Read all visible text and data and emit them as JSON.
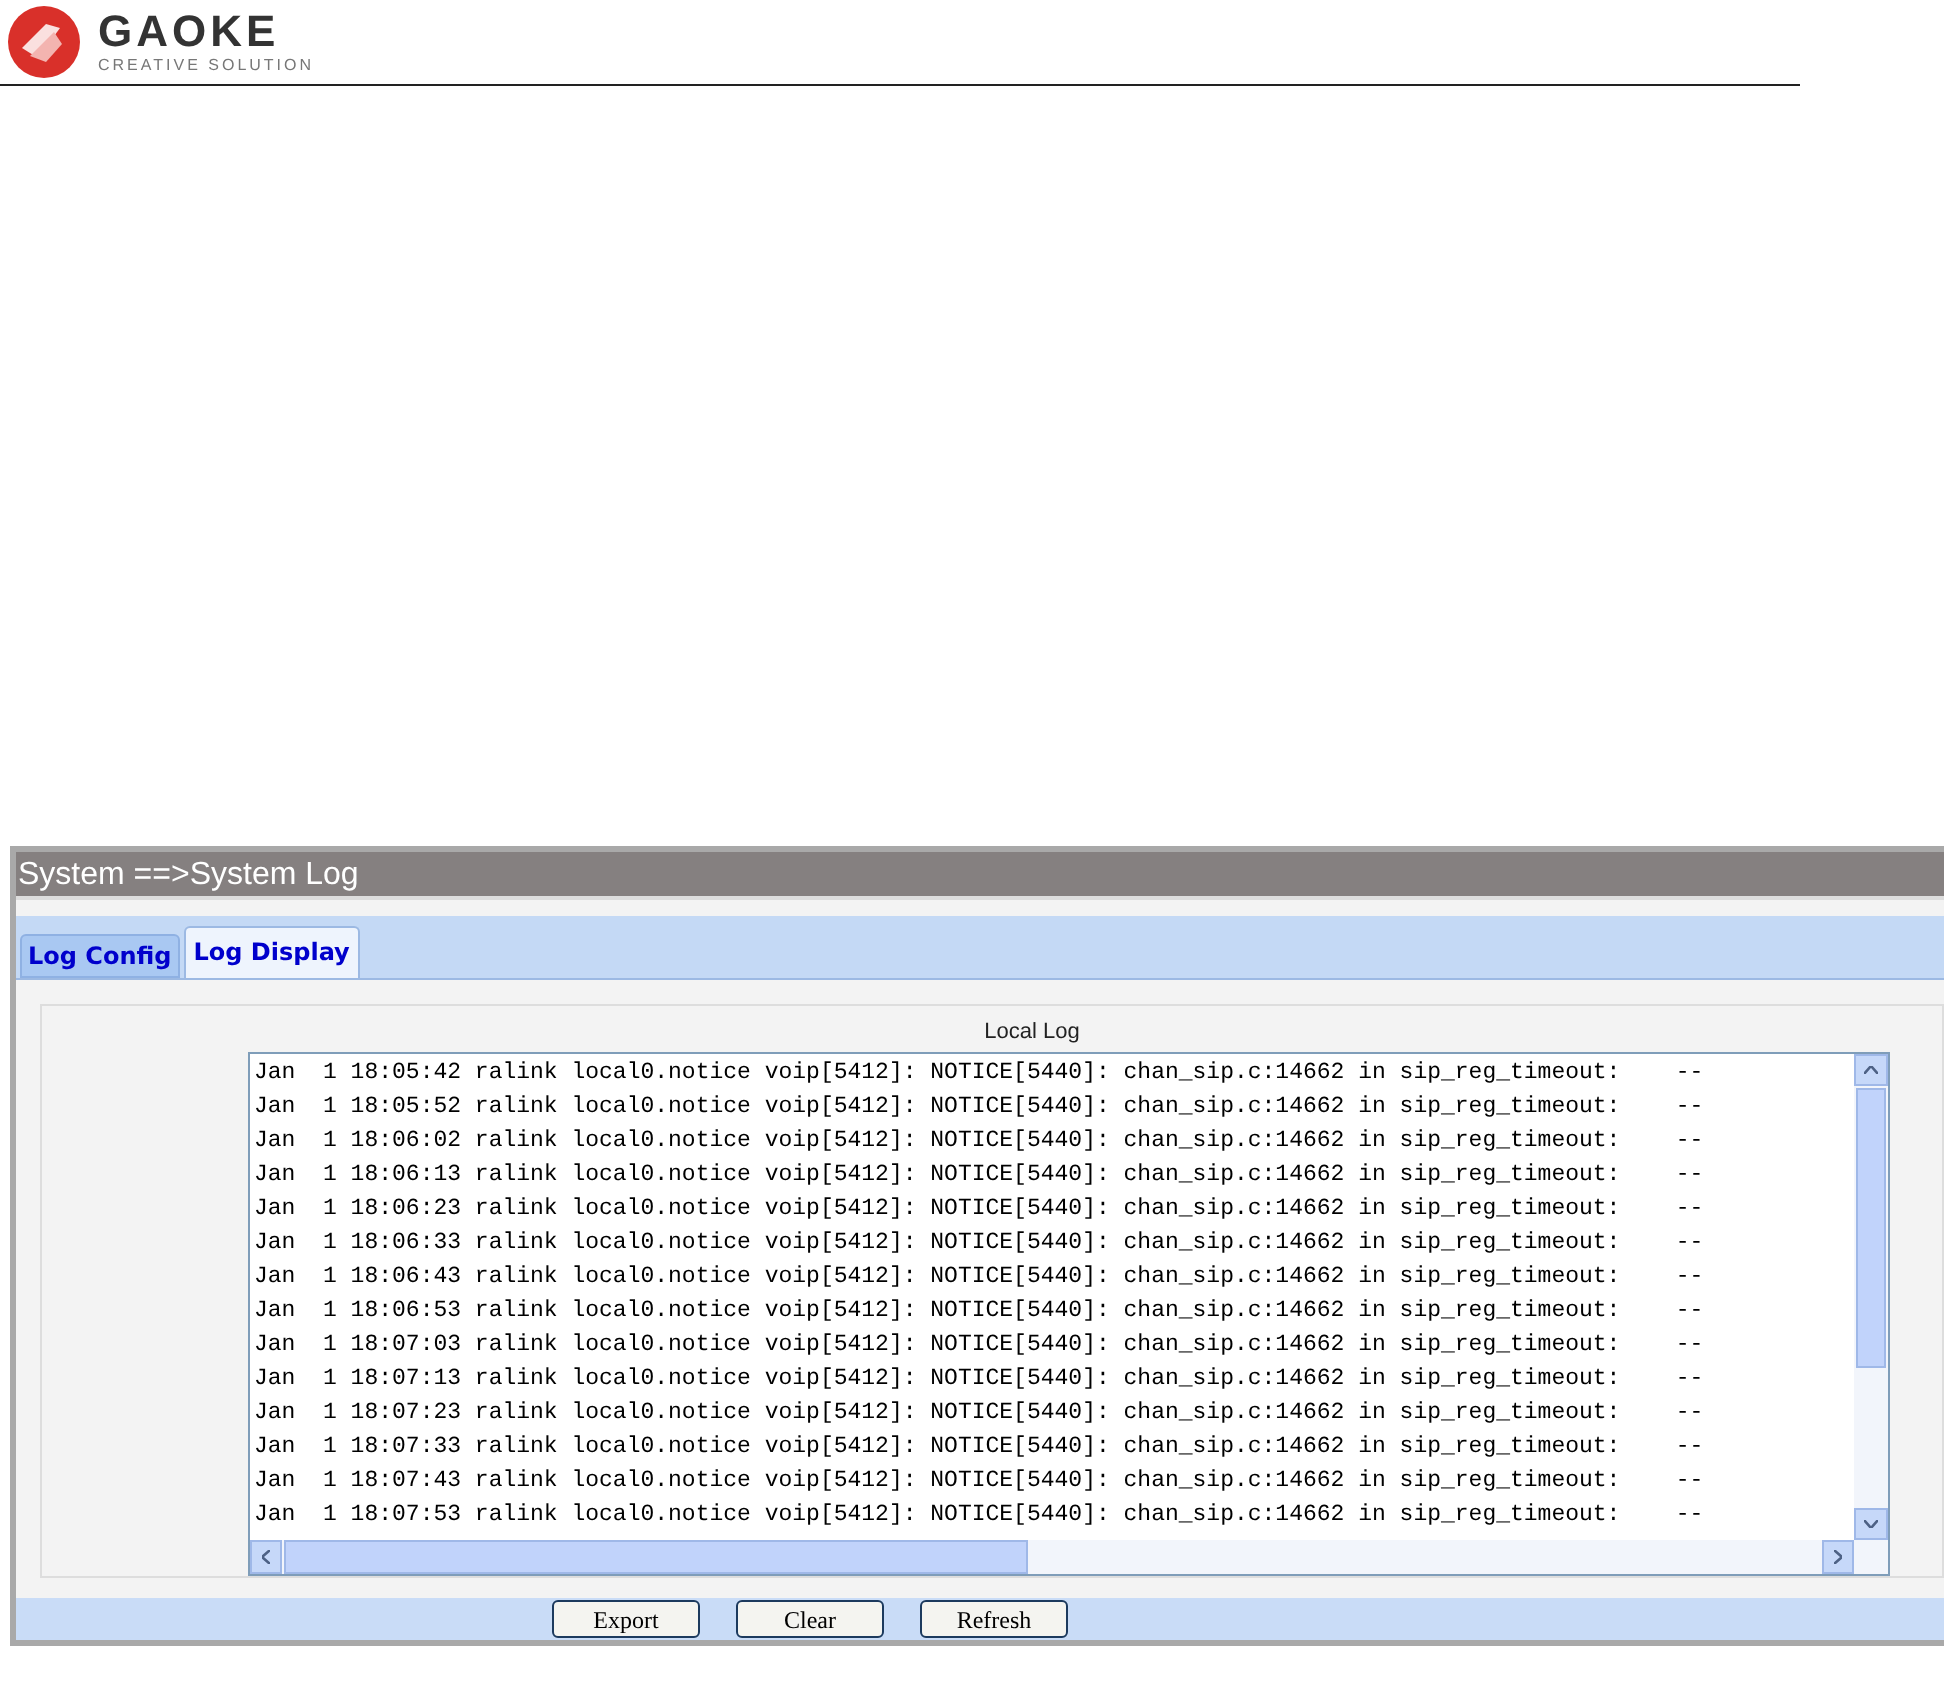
{
  "header": {
    "brand": "GAOKE",
    "tagline": "CREATIVE SOLUTION"
  },
  "panel": {
    "title": "System ==>System Log"
  },
  "tabs": [
    {
      "label": "Log Config",
      "selected": false
    },
    {
      "label": "Log Display",
      "selected": true
    }
  ],
  "log": {
    "legend": "Local Log",
    "lines": [
      "Jan  1 18:05:42 ralink local0.notice voip[5412]: NOTICE[5440]: chan_sip.c:14662 in sip_reg_timeout:    --",
      "Jan  1 18:05:52 ralink local0.notice voip[5412]: NOTICE[5440]: chan_sip.c:14662 in sip_reg_timeout:    --",
      "Jan  1 18:06:02 ralink local0.notice voip[5412]: NOTICE[5440]: chan_sip.c:14662 in sip_reg_timeout:    --",
      "Jan  1 18:06:13 ralink local0.notice voip[5412]: NOTICE[5440]: chan_sip.c:14662 in sip_reg_timeout:    --",
      "Jan  1 18:06:23 ralink local0.notice voip[5412]: NOTICE[5440]: chan_sip.c:14662 in sip_reg_timeout:    --",
      "Jan  1 18:06:33 ralink local0.notice voip[5412]: NOTICE[5440]: chan_sip.c:14662 in sip_reg_timeout:    --",
      "Jan  1 18:06:43 ralink local0.notice voip[5412]: NOTICE[5440]: chan_sip.c:14662 in sip_reg_timeout:    --",
      "Jan  1 18:06:53 ralink local0.notice voip[5412]: NOTICE[5440]: chan_sip.c:14662 in sip_reg_timeout:    --",
      "Jan  1 18:07:03 ralink local0.notice voip[5412]: NOTICE[5440]: chan_sip.c:14662 in sip_reg_timeout:    --",
      "Jan  1 18:07:13 ralink local0.notice voip[5412]: NOTICE[5440]: chan_sip.c:14662 in sip_reg_timeout:    --",
      "Jan  1 18:07:23 ralink local0.notice voip[5412]: NOTICE[5440]: chan_sip.c:14662 in sip_reg_timeout:    --",
      "Jan  1 18:07:33 ralink local0.notice voip[5412]: NOTICE[5440]: chan_sip.c:14662 in sip_reg_timeout:    --",
      "Jan  1 18:07:43 ralink local0.notice voip[5412]: NOTICE[5440]: chan_sip.c:14662 in sip_reg_timeout:    --",
      "Jan  1 18:07:53 ralink local0.notice voip[5412]: NOTICE[5440]: chan_sip.c:14662 in sip_reg_timeout:    --"
    ]
  },
  "buttons": [
    "Export",
    "Clear",
    "Refresh"
  ]
}
